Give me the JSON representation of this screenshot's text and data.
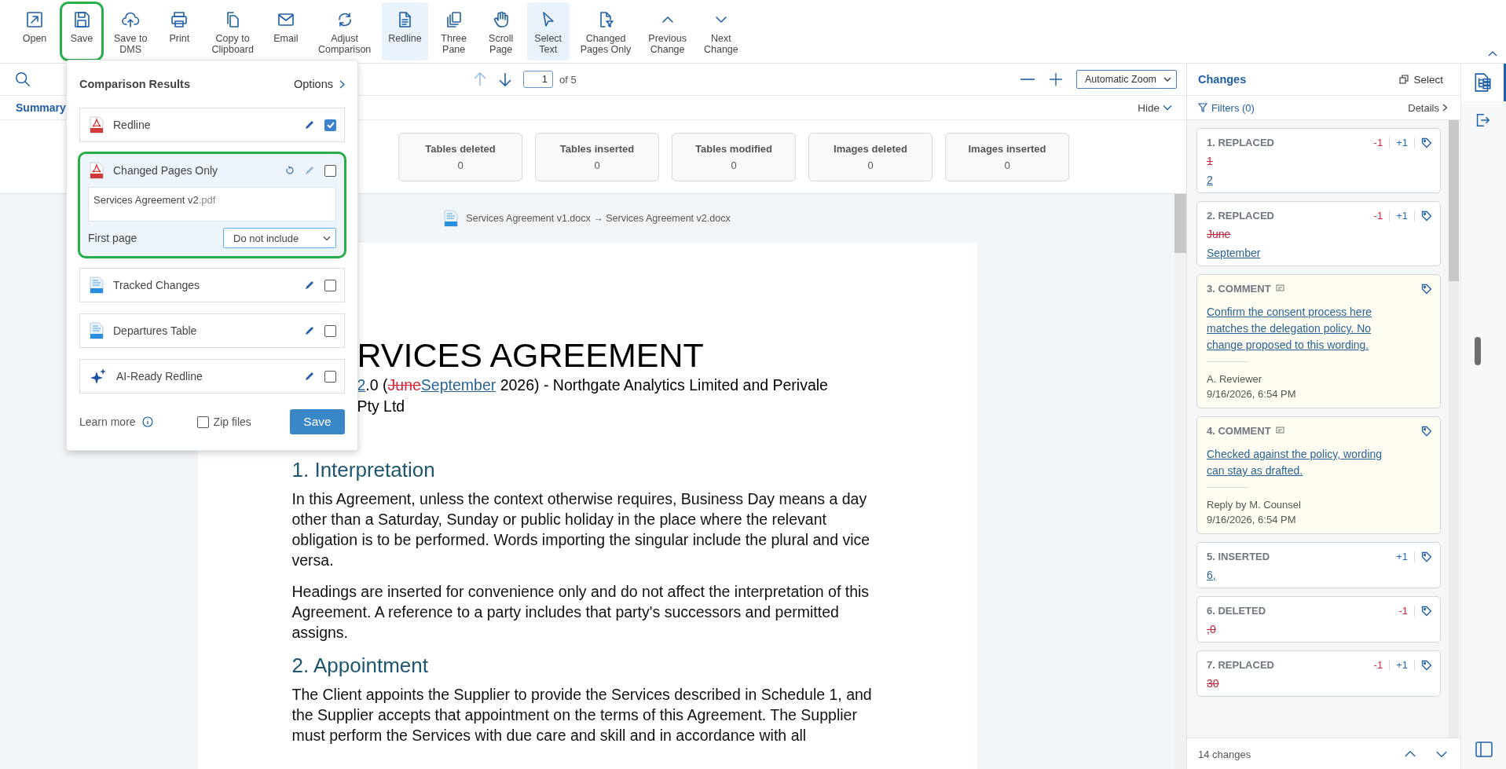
{
  "toolbar": {
    "buttons": [
      {
        "kind": "open",
        "label": "Open",
        "selected": false,
        "highlighted": false
      },
      {
        "kind": "save",
        "label": "Save",
        "selected": false,
        "highlighted": true
      },
      {
        "kind": "cloud",
        "label": "Save to\nDMS",
        "selected": false,
        "highlighted": false
      },
      {
        "kind": "print",
        "label": "Print",
        "selected": false,
        "highlighted": false
      },
      {
        "kind": "copy",
        "label": "Copy to\nClipboard",
        "selected": false,
        "highlighted": false
      },
      {
        "kind": "email",
        "label": "Email",
        "selected": false,
        "highlighted": false
      },
      {
        "kind": "refresh",
        "label": "Adjust\nComparison",
        "selected": false,
        "highlighted": false
      },
      {
        "kind": "doc",
        "label": "Redline",
        "selected": true,
        "highlighted": false
      },
      {
        "kind": "pages",
        "label": "Three\nPane",
        "selected": false,
        "highlighted": false
      },
      {
        "kind": "hand",
        "label": "Scroll\nPage",
        "selected": false,
        "highlighted": false
      },
      {
        "kind": "pointer",
        "label": "Select\nText",
        "selected": true,
        "highlighted": false
      },
      {
        "kind": "filterdoc",
        "label": "Changed\nPages Only",
        "selected": false,
        "highlighted": false
      },
      {
        "kind": "up",
        "label": "Previous\nChange",
        "selected": false,
        "highlighted": false
      },
      {
        "kind": "down",
        "label": "Next\nChange",
        "selected": false,
        "highlighted": false
      }
    ]
  },
  "page_nav": {
    "up_disabled": true,
    "page": "1",
    "of": "of 5",
    "zoom": "Automatic Zoom"
  },
  "summary": {
    "tab": "Summary",
    "hide": "Hide",
    "cards": [
      {
        "label": "Tables deleted",
        "value": "0"
      },
      {
        "label": "Tables inserted",
        "value": "0"
      },
      {
        "label": "Tables modified",
        "value": "0"
      },
      {
        "label": "Images deleted",
        "value": "0"
      },
      {
        "label": "Images inserted",
        "value": "0"
      }
    ]
  },
  "document": {
    "header": "Services Agreement v1.docx → Services Agreement v2.docx",
    "title": "RVICES AGREEMENT",
    "subtitle_lines": [
      [
        {
          "kind": "inserted",
          "text": "2"
        },
        {
          "kind": "plain",
          "text": ".0 ("
        },
        {
          "kind": "deleted",
          "text": "June"
        },
        {
          "kind": "inserted",
          "text": "September"
        },
        {
          "kind": "plain",
          "text": " 2026) - Northgate Analytics Limited and Perivale"
        }
      ],
      [
        {
          "kind": "plain",
          "text": "Pty Ltd"
        }
      ]
    ],
    "sections": [
      {
        "heading": "1. Interpretation",
        "paragraphs": [
          "In this Agreement, unless the context otherwise requires, Business Day means a day other than a Saturday, Sunday or public holiday in the place where the relevant obligation is to be performed. Words importing the singular include the plural and vice versa.",
          "Headings are inserted for convenience only and do not affect the interpretation of this Agreement. A reference to a party includes that party's successors and permitted assigns."
        ]
      },
      {
        "heading": "2. Appointment",
        "paragraphs": [
          "The Client appoints the Supplier to provide the Services described in Schedule 1, and the Supplier accepts that appointment on the terms of this Agreement. The Supplier must perform the Services with due care and skill and in accordance with all"
        ]
      }
    ]
  },
  "save_panel": {
    "title": "Comparison Results",
    "options": "Options",
    "results": [
      {
        "kind": "pdf",
        "label": "Redline",
        "checked": true,
        "expanded": false,
        "highlighted": false,
        "resettable": false,
        "edit_disabled": false
      },
      {
        "kind": "pdf",
        "label": "Changed Pages Only",
        "checked": false,
        "expanded": true,
        "highlighted": true,
        "resettable": true,
        "edit_disabled": true,
        "filename": "Services Agreement v2",
        "extension": ".pdf",
        "option_label": "First page",
        "option_value": "Do not include"
      },
      {
        "kind": "docx",
        "label": "Tracked Changes",
        "checked": false,
        "expanded": false,
        "highlighted": false,
        "resettable": false,
        "edit_disabled": false
      },
      {
        "kind": "docx",
        "label": "Departures Table",
        "checked": false,
        "expanded": false,
        "highlighted": false,
        "resettable": false,
        "edit_disabled": false
      },
      {
        "kind": "ai",
        "label": "AI-Ready Redline",
        "checked": false,
        "expanded": false,
        "highlighted": false,
        "resettable": false,
        "edit_disabled": false
      }
    ],
    "learn_more": "Learn more",
    "zip_files": {
      "label": "Zip files",
      "checked": false
    },
    "save": "Save"
  },
  "changes_panel": {
    "title": "Changes",
    "select": "Select",
    "filters": "Filters (0)",
    "details": "Details",
    "count": "14 changes",
    "changes": [
      {
        "kind": "replaced",
        "title": "1. REPLACED",
        "removed": "-1",
        "added": "+1",
        "deleted_text": "1",
        "inserted_text": "2"
      },
      {
        "kind": "replaced",
        "title": "2. REPLACED",
        "removed": "-1",
        "added": "+1",
        "deleted_text": "June",
        "inserted_text": "September"
      },
      {
        "kind": "comment",
        "title": "3. COMMENT",
        "text": "Confirm the consent process here matches the delegation policy. No change proposed to this wording.",
        "author": "A. Reviewer",
        "date": "9/16/2026, 6:54 PM"
      },
      {
        "kind": "comment",
        "title": "4. COMMENT",
        "text": "Checked against the policy, wording can stay as drafted.",
        "author": "Reply by M. Counsel",
        "date": "9/16/2026, 6:54 PM"
      },
      {
        "kind": "inserted",
        "title": "5. INSERTED",
        "added": "+1",
        "inserted_text": "6,"
      },
      {
        "kind": "deleted",
        "title": "6. DELETED",
        "removed": "-1",
        "deleted_text": ",0"
      },
      {
        "kind": "replaced",
        "title": "7. REPLACED",
        "removed": "-1",
        "added": "+1",
        "deleted_text": "30"
      }
    ]
  },
  "rail": [
    {
      "kind": "changes",
      "selected": true
    },
    {
      "kind": "exit",
      "selected": false
    }
  ]
}
